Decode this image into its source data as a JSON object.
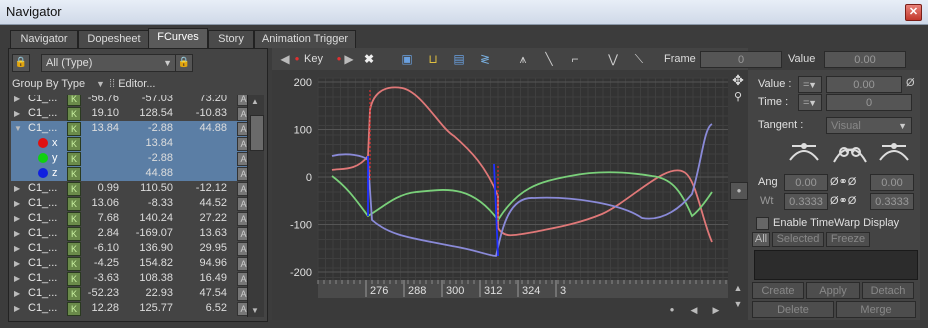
{
  "window": {
    "title": "Navigator",
    "close_glyph": "✕"
  },
  "tabs": [
    {
      "label": "Navigator"
    },
    {
      "label": "Dopesheet"
    },
    {
      "label": "FCurves"
    },
    {
      "label": "Story"
    },
    {
      "label": "Animation Trigger"
    }
  ],
  "left": {
    "filter_value": "All (Type)",
    "group_by_label": "Group By Type",
    "editor_label": "Editor...",
    "rows": [
      {
        "name": "C1_...",
        "v": [
          "-56.76",
          "-57.03",
          "73.20"
        ],
        "type": "item"
      },
      {
        "name": "C1_...",
        "v": [
          "19.10",
          "128.54",
          "-10.83"
        ],
        "type": "item"
      },
      {
        "name": "C1_...",
        "v": [
          "13.84",
          "-2.88",
          "44.88"
        ],
        "type": "open"
      },
      {
        "name": "x",
        "v": [
          "",
          "13.84",
          ""
        ],
        "type": "axis",
        "color": "#e01010"
      },
      {
        "name": "y",
        "v": [
          "",
          "-2.88",
          ""
        ],
        "type": "axis",
        "color": "#10d010"
      },
      {
        "name": "z",
        "v": [
          "",
          "44.88",
          ""
        ],
        "type": "axis",
        "color": "#1020e0"
      },
      {
        "name": "C1_...",
        "v": [
          "0.99",
          "110.50",
          "-12.12"
        ],
        "type": "item"
      },
      {
        "name": "C1_...",
        "v": [
          "13.06",
          "-8.33",
          "44.52"
        ],
        "type": "item"
      },
      {
        "name": "C1_...",
        "v": [
          "7.68",
          "140.24",
          "27.22"
        ],
        "type": "item"
      },
      {
        "name": "C1_...",
        "v": [
          "2.84",
          "-169.07",
          "13.63"
        ],
        "type": "item"
      },
      {
        "name": "C1_...",
        "v": [
          "-6.10",
          "136.90",
          "29.95"
        ],
        "type": "item"
      },
      {
        "name": "C1_...",
        "v": [
          "-4.25",
          "154.82",
          "94.96"
        ],
        "type": "item"
      },
      {
        "name": "C1_...",
        "v": [
          "-3.63",
          "108.38",
          "16.49"
        ],
        "type": "item"
      },
      {
        "name": "C1_...",
        "v": [
          "-52.23",
          "22.93",
          "47.54"
        ],
        "type": "item"
      },
      {
        "name": "C1_...",
        "v": [
          "12.28",
          "125.77",
          "6.52"
        ],
        "type": "item"
      }
    ]
  },
  "toolbar": {
    "key_label": "Key",
    "frame_label": "Frame",
    "frame_value": "0",
    "value_label": "Value",
    "value_value": "0.00"
  },
  "graph": {
    "y_labels": [
      "200",
      "100",
      "0",
      "-100",
      "-200"
    ],
    "x_labels": [
      "276",
      "288",
      "300",
      "312",
      "324",
      "3"
    ],
    "curve_colors": {
      "x": "#e07878",
      "y": "#7ad07a",
      "z": "#8a8ad8"
    }
  },
  "right": {
    "value_label": "Value :",
    "value_op": "=",
    "value_field": "0.00",
    "value_slash": "Ø",
    "time_label": "Time :",
    "time_op": "=",
    "time_field": "0",
    "tangent_label": "Tangent :",
    "tangent_value": "Visual",
    "ang_label": "Ang",
    "ang_left": "0.00",
    "ang_right": "0.00",
    "wt_label": "Wt",
    "wt_left": "0.3333",
    "wt_right": "0.3333",
    "timewarp_label": "Enable TimeWarp Display",
    "tab_all": "All",
    "tab_selected": "Selected",
    "tab_freeze": "Freeze",
    "btn_create": "Create",
    "btn_apply": "Apply",
    "btn_detach": "Detach",
    "btn_delete": "Delete",
    "btn_merge": "Merge"
  }
}
